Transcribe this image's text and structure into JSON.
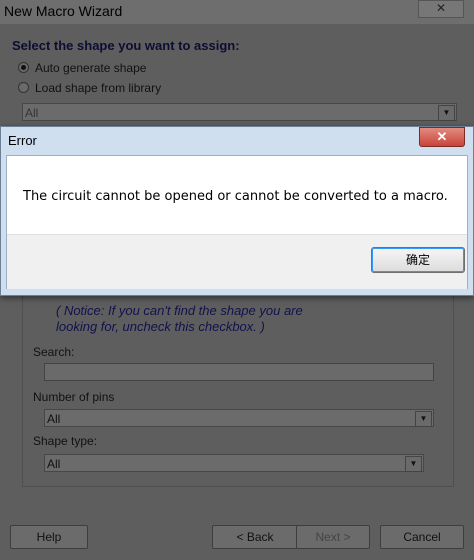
{
  "wizard": {
    "title": "New Macro Wizard",
    "close_glyph": "✕",
    "heading": "Select the shape you want to assign:",
    "radio_auto": "Auto generate shape",
    "radio_library": "Load shape from library",
    "library_combo_value": "All",
    "notice_line1": "( Notice: If you can't find the shape you are",
    "notice_line2": "looking for, uncheck this checkbox. )",
    "search_label": "Search:",
    "pins_label": "Number of pins",
    "pins_value": "All",
    "shape_type_label": "Shape type:",
    "shape_type_value": "All",
    "help_button": "Help",
    "back_button": "< Back",
    "next_button": "Next >",
    "cancel_button": "Cancel"
  },
  "error_dialog": {
    "title": "Error",
    "close_glyph": "✕",
    "message": "The circuit cannot be opened or cannot be converted to a macro.",
    "ok_button": "确定"
  }
}
